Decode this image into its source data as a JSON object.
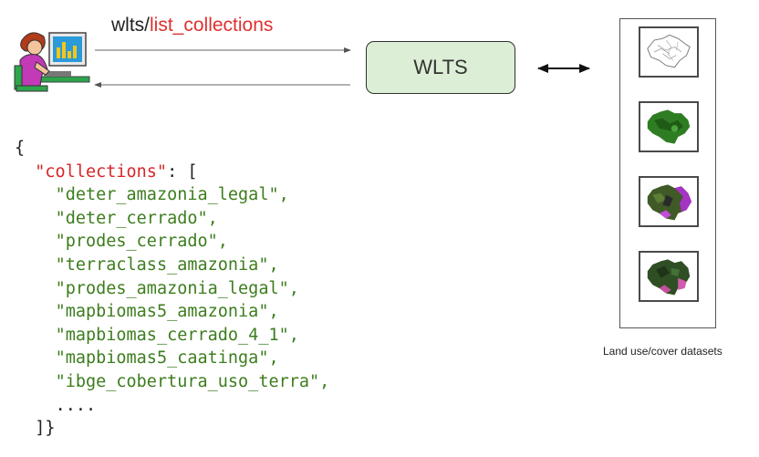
{
  "request": {
    "prefix": "wlts/",
    "endpoint": "list_collections"
  },
  "service": {
    "label": "WLTS"
  },
  "datasets": {
    "caption": "Land use/cover datasets",
    "thumbnails": [
      "boundary-outline-map",
      "green-cover-map",
      "purple-classification-map",
      "pink-classification-map"
    ]
  },
  "response": {
    "open_brace": "{",
    "key": "\"collections\"",
    "key_suffix": ": [",
    "items": [
      "\"deter_amazonia_legal\",",
      "\"deter_cerrado\",",
      "\"prodes_cerrado\",",
      "\"terraclass_amazonia\",",
      "\"prodes_amazonia_legal\",",
      "\"mapbiomas5_amazonia\",",
      "\"mapbiomas_cerrado_4_1\",",
      "\"mapbiomas5_caatinga\",",
      "\"ibge_cobertura_uso_terra\","
    ],
    "ellipsis": "....",
    "close": "]}"
  },
  "colors": {
    "accent": "#e03030",
    "key": "#d7262a",
    "string": "#3d7d1e",
    "box_fill": "#dcefd6"
  }
}
